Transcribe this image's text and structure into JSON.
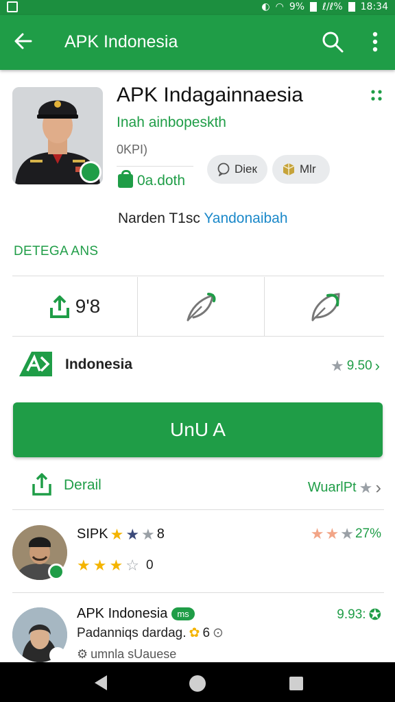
{
  "status_bar": {
    "battery_text": "9%",
    "signal_text": "ℓ/ℓ%",
    "time": "18:34"
  },
  "app_bar": {
    "title": "APK Indonesia",
    "back_icon": "arrow-left-icon",
    "search_icon": "search-icon",
    "more_icon": "more-vert-icon"
  },
  "app": {
    "title": "APK Indagainnaesia",
    "subtitle": "Inah ainbopeskth",
    "version": "0KPI)",
    "size": "0a.doth",
    "chips": [
      "Dieк",
      "Mlr"
    ],
    "dev_prefix": "Narden T1sc",
    "dev_link": "Yandonaibah"
  },
  "section": {
    "label": "DETEGA ANS"
  },
  "stats": {
    "count": "9'8"
  },
  "publisher_row": {
    "name": "Indonesia",
    "rating": "9.50"
  },
  "install": {
    "label": "UnU A"
  },
  "detail_row": {
    "label": "Derail",
    "right_text": "WuarlPt"
  },
  "reviews": [
    {
      "name": "SIPK",
      "name_suffix": "8",
      "rating_right": "27%",
      "count": "0"
    },
    {
      "name": "APK Indonesia",
      "pill": "ms",
      "rating_right": "9.93:",
      "text": "Padanniqs dardag.",
      "text_suffix": "6",
      "footer": "umnla sUauese"
    }
  ],
  "colors": {
    "primary": "#1f9d47",
    "status_bar": "#1c8f3f",
    "link": "#1a88c9",
    "star": "#f4b400"
  }
}
